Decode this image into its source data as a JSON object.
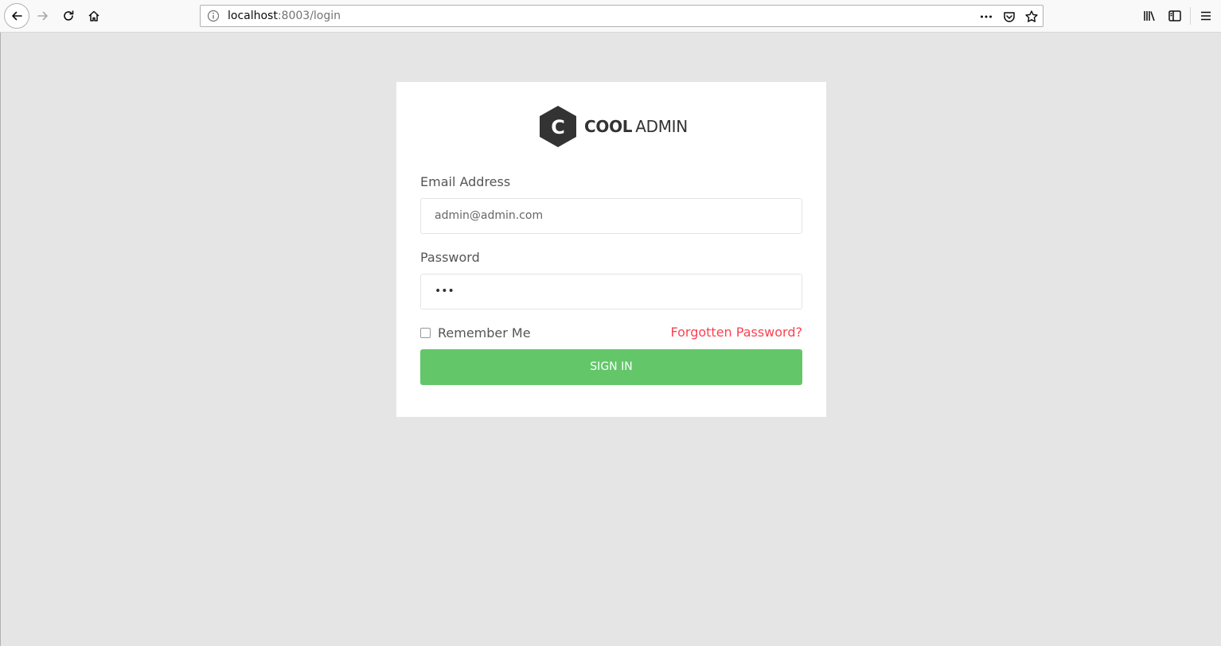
{
  "browser": {
    "url_host": "localhost",
    "url_rest": ":8003/login",
    "icons": {
      "back": "back-arrow-icon",
      "forward": "forward-arrow-icon",
      "reload": "reload-icon",
      "home": "home-icon",
      "info": "info-icon",
      "more": "more-actions-icon",
      "pocket": "pocket-icon",
      "bookmark": "star-icon",
      "library": "library-icon",
      "sidebar": "sidebar-icon",
      "menu": "hamburger-menu-icon"
    }
  },
  "login": {
    "logo_letter": "C",
    "logo_bold": "COOL",
    "logo_light": "ADMIN",
    "email_label": "Email Address",
    "email_value": "admin@admin.com",
    "password_label": "Password",
    "password_mask": "•••",
    "remember_label": "Remember Me",
    "remember_checked": false,
    "forgot_link": "Forgotten Password?",
    "signin_label": "SIGN IN"
  },
  "colors": {
    "page_background": "#e5e5e5",
    "button_green": "#63c76a",
    "link_red": "#fa4251",
    "logo_dark": "#333333"
  }
}
